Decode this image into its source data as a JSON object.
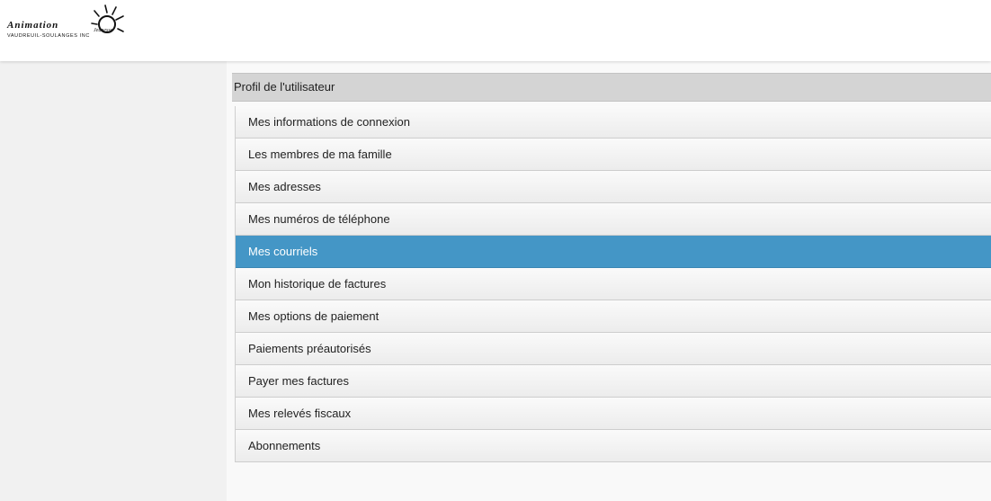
{
  "logo": {
    "name": "Animation Jeunesse",
    "subtitle": "VAUDREUIL-SOULANGES INC"
  },
  "panel": {
    "title": "Profil de l'utilisateur"
  },
  "menu": {
    "active_index": 4,
    "active_color": "#4496c6",
    "items": [
      {
        "label": "Mes informations de connexion"
      },
      {
        "label": "Les membres de ma famille"
      },
      {
        "label": "Mes adresses"
      },
      {
        "label": "Mes numéros de téléphone"
      },
      {
        "label": "Mes courriels"
      },
      {
        "label": "Mon historique de factures"
      },
      {
        "label": "Mes options de paiement"
      },
      {
        "label": "Paiements préautorisés"
      },
      {
        "label": "Payer mes factures"
      },
      {
        "label": "Mes relevés fiscaux"
      },
      {
        "label": "Abonnements"
      }
    ]
  }
}
